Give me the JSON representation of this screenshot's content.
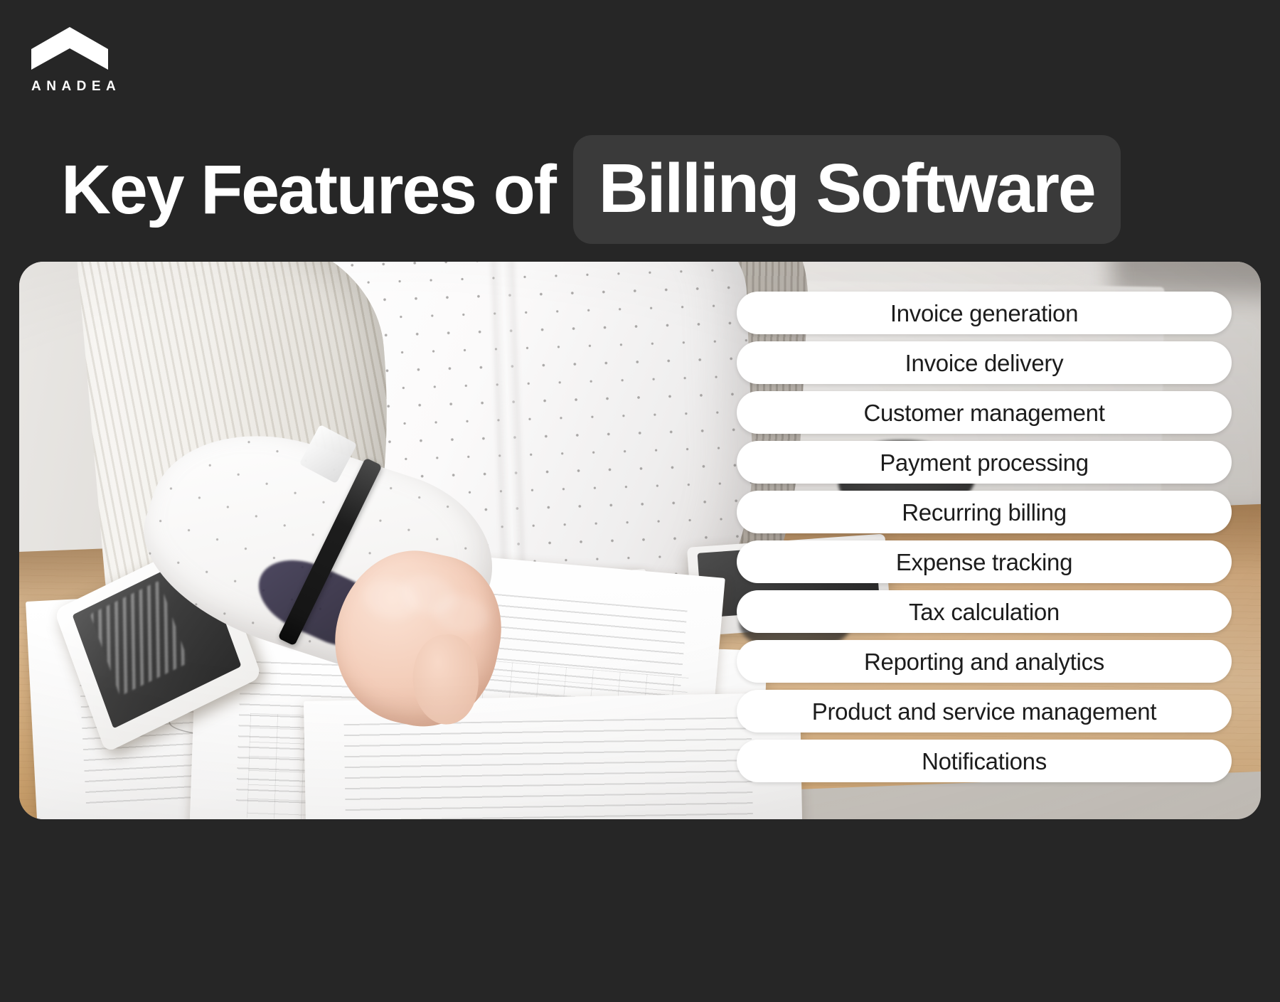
{
  "brand": {
    "name": "ANADEA",
    "logo_icon": "chevron-up-mark",
    "logo_color": "#ffffff"
  },
  "title": {
    "plain_part": "Key Features of",
    "highlight_part": "Billing Software",
    "highlight_background": "#3a3a3a",
    "text_color": "#ffffff"
  },
  "background_color": "#262626",
  "photo": {
    "alt": "Person in white knit cardigan and polka-dot shirt writing with a black pen on printed documents at a light wooden desk, with a white smartphone and tablet nearby",
    "corner_radius_px": 34
  },
  "features": {
    "pill_background": "#ffffff",
    "pill_text_color": "#1c1c1c",
    "items": [
      {
        "label": "Invoice generation"
      },
      {
        "label": "Invoice delivery"
      },
      {
        "label": "Customer management"
      },
      {
        "label": "Payment processing"
      },
      {
        "label": "Recurring billing"
      },
      {
        "label": "Expense tracking"
      },
      {
        "label": "Tax calculation"
      },
      {
        "label": "Reporting and analytics"
      },
      {
        "label": "Product and service management"
      },
      {
        "label": "Notifications"
      }
    ]
  }
}
